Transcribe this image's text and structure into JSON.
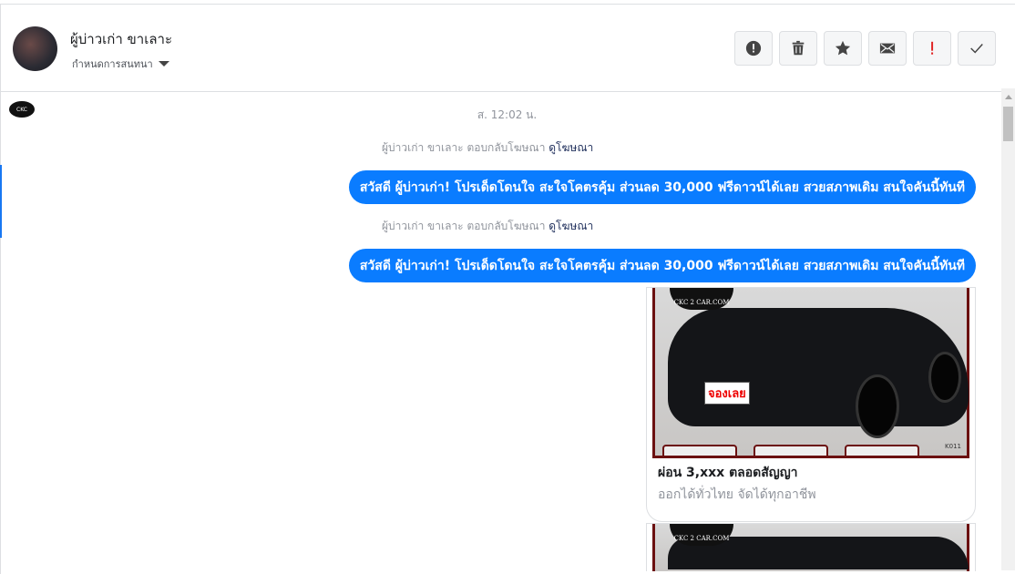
{
  "header": {
    "contact_name": "ผู้บ่าวเก่า ขาเลาะ",
    "conversation_settings": "กำหนดการสนทนา"
  },
  "toolbar": [
    {
      "name": "spam-button",
      "icon": "exclamation-circle-icon"
    },
    {
      "name": "delete-button",
      "icon": "trash-icon"
    },
    {
      "name": "star-button",
      "icon": "star-icon"
    },
    {
      "name": "mark-unread-button",
      "icon": "envelope-icon"
    },
    {
      "name": "priority-button",
      "icon": "exclamation-icon",
      "color": "#e02424"
    },
    {
      "name": "done-button",
      "icon": "check-icon"
    }
  ],
  "chat": {
    "page_logo": "CKC",
    "timestamp": "ส. 12:02 น.",
    "messages": [
      {
        "note": "ผู้บ่าวเก่า ขาเลาะ ตอบกลับโฆษณา",
        "note_link": "ดูโฆษณา",
        "text": "สวัสดี ผู้บ่าวเก่า! โปรเด็ดโดนใจ สะใจโคตรคุ้ม ส่วนลด 30,000 ฟรีดาวน์ได้เลย สวยสภาพเดิม สนใจคันนี้ทันที"
      },
      {
        "note": "ผู้บ่าวเก่า ขาเลาะ ตอบกลับโฆษณา",
        "note_link": "ดูโฆษณา",
        "text": "สวัสดี ผู้บ่าวเก่า! โปรเด็ดโดนใจ สะใจโคตรคุ้ม ส่วนลด 30,000 ฟรีดาวน์ได้เลย สวยสภาพเดิม สนใจคันนี้ทันที"
      }
    ],
    "cards": [
      {
        "logo": "CKC 2 CAR.COM",
        "badge": "จองเลย",
        "code": "K011",
        "title": "ผ่อน 3,xxx ตลอดสัญญา",
        "subtitle": "ออกได้ทั่วไทย จัดได้ทุกอาชีพ"
      },
      {
        "logo": "CKC 2 CAR.COM"
      }
    ]
  },
  "colors": {
    "bubble": "#0a7cff",
    "accent": "#1877f2"
  }
}
